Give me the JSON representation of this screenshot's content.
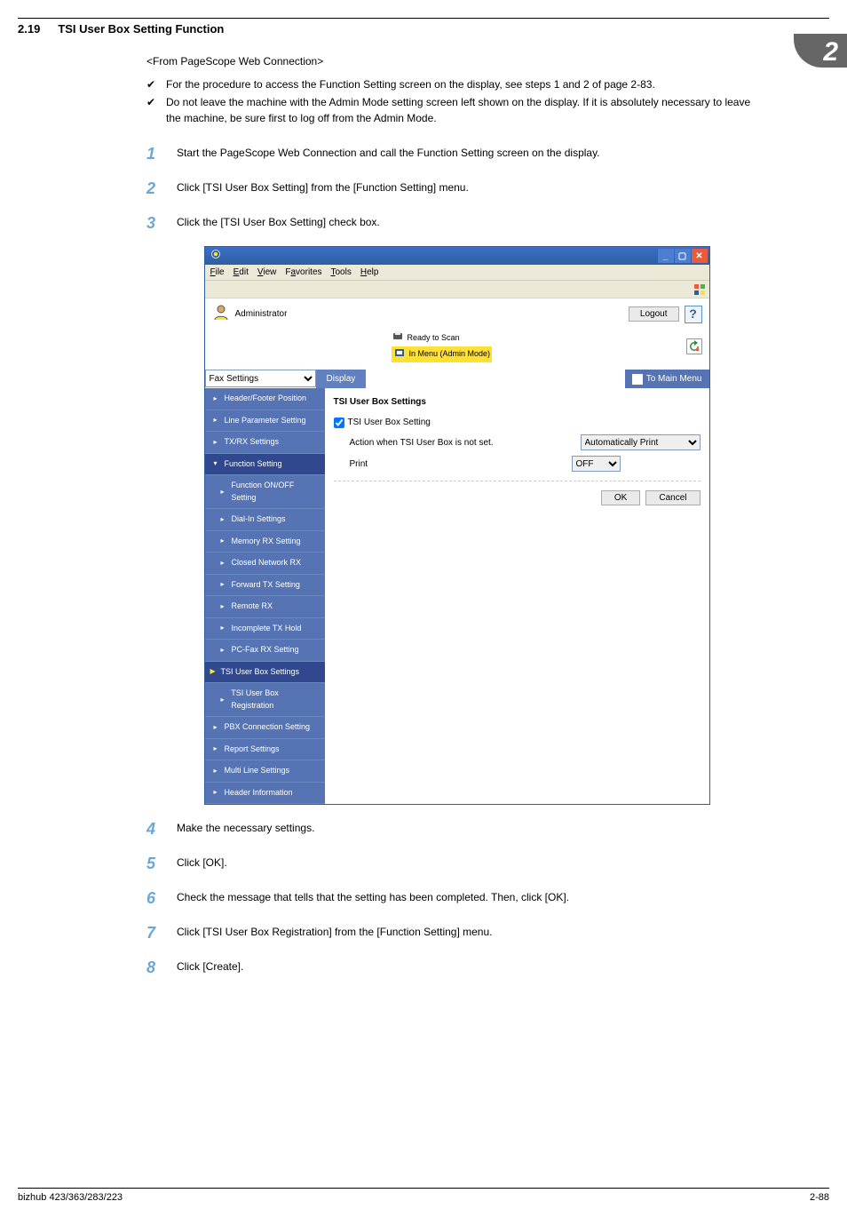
{
  "header": {
    "section": "2.19",
    "title": "TSI User Box Setting Function",
    "chapterNumber": "2"
  },
  "intro": {
    "subtitle": "<From PageScope Web Connection>"
  },
  "checks": [
    "For the procedure to access the Function Setting screen on the display, see steps 1 and 2 of page 2-83.",
    "Do not leave the machine with the Admin Mode setting screen left shown on the display. If it is absolutely necessary to leave the machine, be sure first to log off from the Admin Mode."
  ],
  "steps": {
    "s1": "Start the PageScope Web Connection and call the Function Setting screen on the display.",
    "s2": "Click [TSI User Box Setting] from the [Function Setting] menu.",
    "s3": "Click the [TSI User Box Setting] check box.",
    "s4": "Make the necessary settings.",
    "s5": "Click [OK].",
    "s6": "Check the message that tells that the setting has been completed. Then, click [OK].",
    "s7": "Click [TSI User Box Registration] from the [Function Setting] menu.",
    "s8": "Click [Create]."
  },
  "ie": {
    "menus": {
      "file": "File",
      "edit": "Edit",
      "view": "View",
      "favorites": "Favorites",
      "tools": "Tools",
      "help": "Help"
    },
    "adminLabel": "Administrator",
    "logout": "Logout",
    "statusReady": "Ready to Scan",
    "statusMode": "In Menu (Admin Mode)",
    "categorySelect": "Fax Settings",
    "displayTab": "Display",
    "toMainMenu": "To Main Menu"
  },
  "sidebar": {
    "items": {
      "hfp": "Header/Footer Position",
      "lps": "Line Parameter Setting",
      "txrx": "TX/RX Settings",
      "fs": "Function Setting",
      "foo": "Function ON/OFF Setting",
      "dial": "Dial-In Settings",
      "mem": "Memory RX Setting",
      "closed": "Closed Network RX",
      "fwd": "Forward TX Setting",
      "remote": "Remote RX",
      "inc": "Incomplete TX Hold",
      "pcfax": "PC-Fax RX Setting",
      "tsi": "TSI User Box Settings",
      "tsireg": "TSI User Box Registration",
      "pbx": "PBX Connection Setting",
      "report": "Report Settings",
      "multi": "Multi Line Settings",
      "hinfo": "Header Information"
    }
  },
  "panel": {
    "title": "TSI User Box Settings",
    "checkboxLabel": "TSI User Box Setting",
    "row1label": "Action when TSI User Box is not set.",
    "row1select": "Automatically Print",
    "row2label": "Print",
    "row2select": "OFF",
    "ok": "OK",
    "cancel": "Cancel"
  },
  "footer": {
    "left": "bizhub 423/363/283/223",
    "right": "2-88"
  }
}
